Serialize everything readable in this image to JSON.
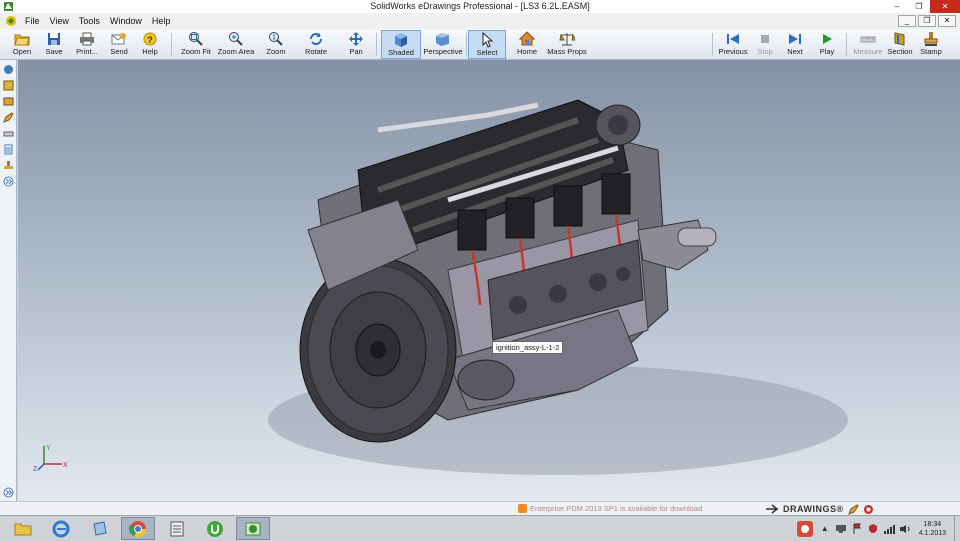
{
  "window": {
    "title": "SolidWorks eDrawings Professional - [LS3 6.2L.EASM]",
    "minimize": "–",
    "restore": "❐",
    "close": "✕"
  },
  "menu": [
    "File",
    "View",
    "Tools",
    "Window",
    "Help"
  ],
  "mdi_controls": [
    "_",
    "❐",
    "✕"
  ],
  "toolbar": {
    "open": "Open",
    "save": "Save",
    "print": "Print...",
    "send": "Send",
    "help": "Help",
    "zoom_fit": "Zoom Fit",
    "zoom_area": "Zoom Area",
    "zoom": "Zoom",
    "rotate": "Rotate",
    "pan": "Pan",
    "shaded": "Shaded",
    "perspective": "Perspective",
    "select": "Select",
    "home": "Home",
    "mass_props": "Mass Props",
    "previous": "Previous",
    "stop": "Stop",
    "next": "Next",
    "play": "Play",
    "measure": "Measure",
    "section": "Section",
    "stamp": "Stamp"
  },
  "viewport": {
    "tooltip": "ignition_assy-L-1-2",
    "triad": {
      "y": "Y",
      "x": "X",
      "z": "Z"
    }
  },
  "status": {
    "update_notice": "Enterprise PDM 2013 SP1 is available for download",
    "brand": "DRAWINGS®"
  },
  "taskbar": {
    "time": "18:34",
    "date": "4.1.2013"
  },
  "colors": {
    "viewport_top": "#8592a6",
    "viewport_bottom": "#e3e8ef",
    "active_button": "#c6dcf6",
    "close_button": "#c42b1c"
  }
}
